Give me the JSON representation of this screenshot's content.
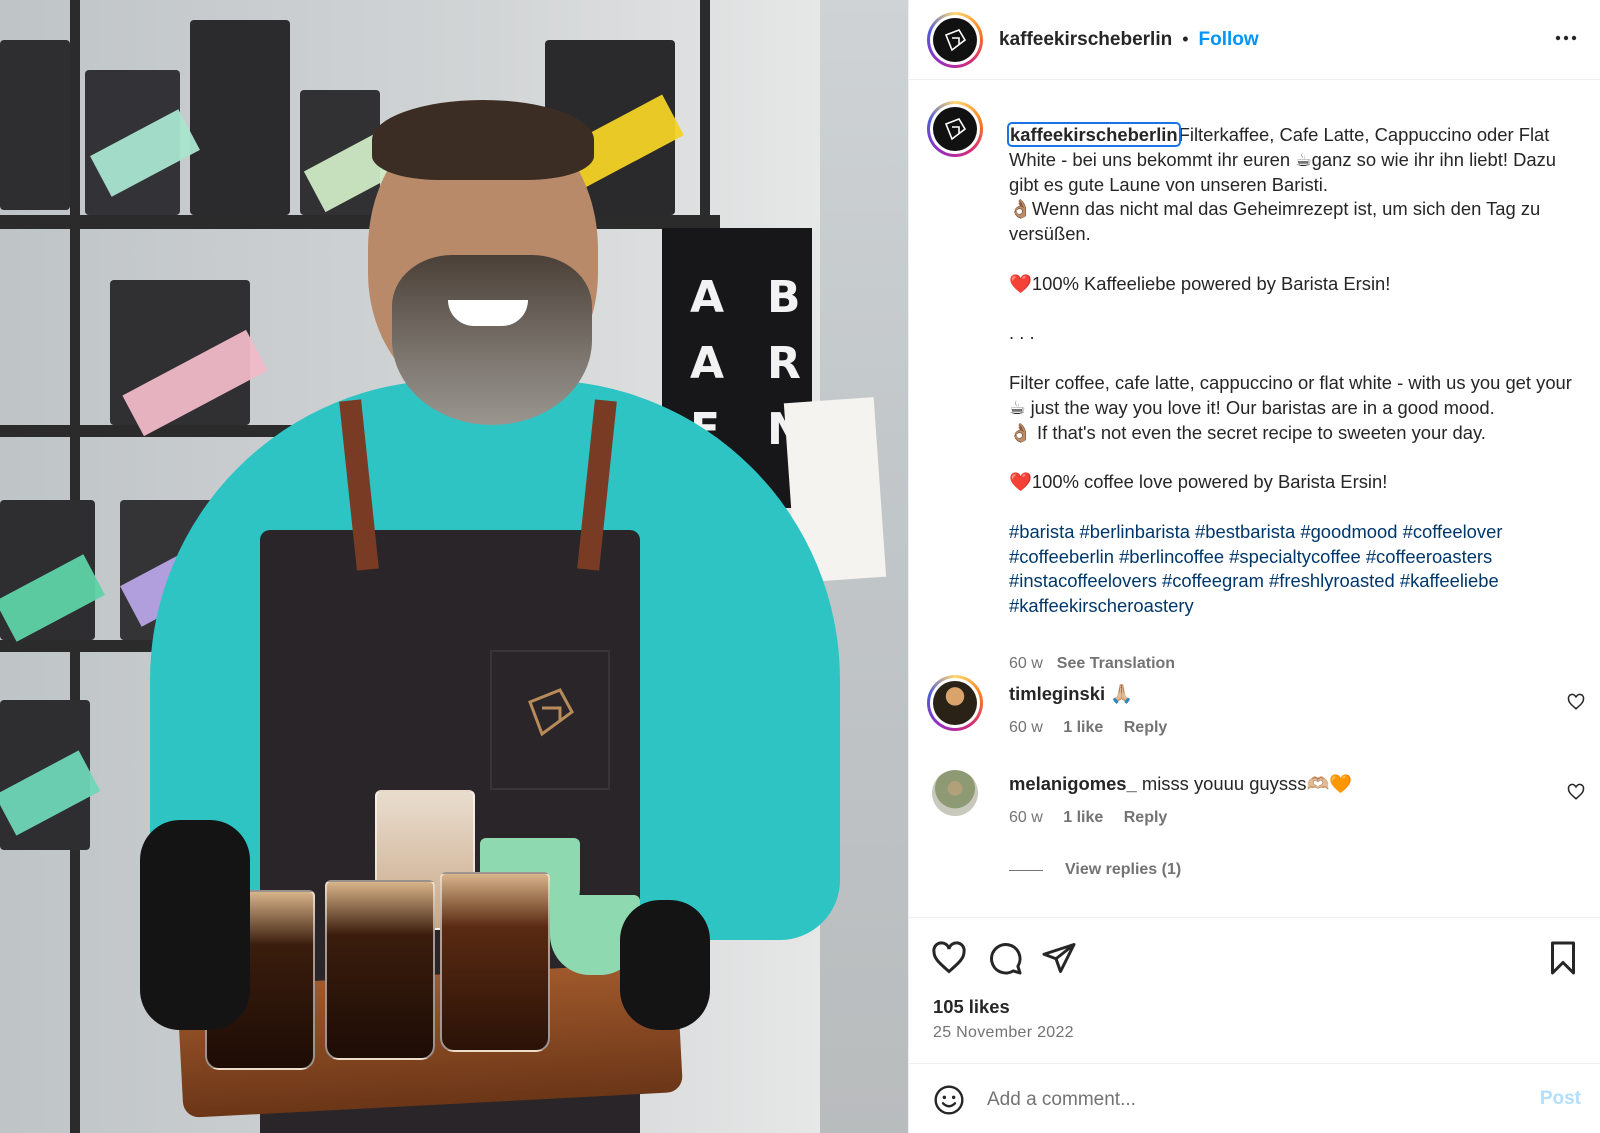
{
  "post": {
    "author": "kaffeekirscheberlin",
    "separator": "•",
    "follow_label": "Follow",
    "more_label": "•••"
  },
  "photo": {
    "tote_letters": [
      "A",
      "A",
      "E",
      "B",
      "R",
      "N"
    ]
  },
  "caption": {
    "username": "kaffeekirscheberlin",
    "body": "Filterkaffee, Cafe Latte, Cappuccino oder Flat White - bei uns bekommt ihr euren ☕ganz so wie ihr ihn liebt! Dazu gibt es gute Laune von unseren Baristi.\n👌🏽Wenn das nicht mal das Geheimrezept ist, um sich den Tag zu versüßen.\n\n❤️100% Kaffeeliebe powered by Barista Ersin!\n\n. . .\n\nFilter coffee, cafe latte, cappuccino or flat white - with us you get your ☕ just the way you love it! Our baristas are in a good mood.\n👌🏽 If that's not even the secret recipe to sweeten your day.\n\n❤️100% coffee love powered by Barista Ersin!\n\n",
    "hashtags": "#barista #berlinbarista #bestbarista #goodmood #coffeelover #coffeeberlin #berlincoffee #specialtycoffee #coffeeroasters #instacoffeelovers #coffeegram #freshlyroasted #kaffeeliebe #kaffeekirscheroastery",
    "age": "60 w",
    "see_translation": "See Translation"
  },
  "comments": [
    {
      "username": "timleginski",
      "text": "🙏🏼",
      "age": "60 w",
      "likes": "1 like",
      "reply": "Reply"
    },
    {
      "username": "melanigomes_",
      "text": "misss youuu guysss🫶🏼🧡",
      "age": "60 w",
      "likes": "1 like",
      "reply": "Reply"
    }
  ],
  "view_replies": "View replies (1)",
  "actions": {
    "likes": "105 likes",
    "date": "25 November 2022"
  },
  "add_comment": {
    "placeholder": "Add a comment...",
    "post_label": "Post"
  },
  "colors": {
    "follow": "#0095f6",
    "hashtag": "#00376b",
    "post_disabled": "#b2dffc",
    "shirt": "#2ec4c4"
  }
}
